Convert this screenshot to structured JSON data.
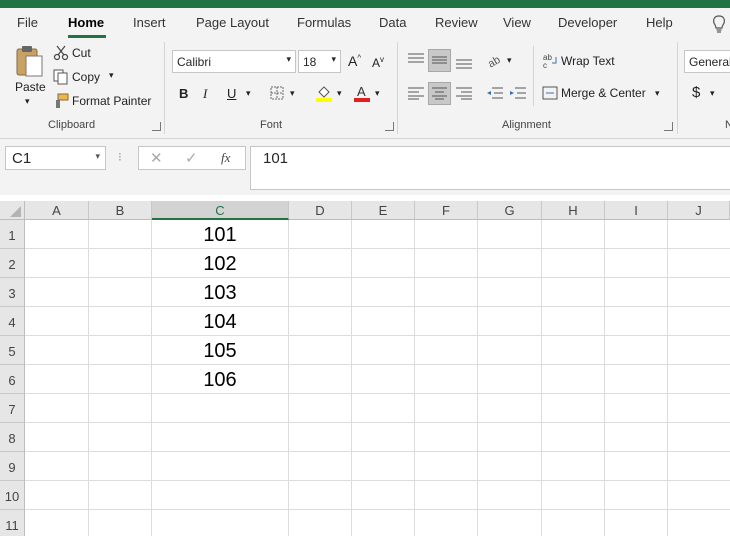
{
  "ribbon_tabs": {
    "file": "File",
    "home": "Home",
    "insert": "Insert",
    "page_layout": "Page Layout",
    "formulas": "Formulas",
    "data": "Data",
    "review": "Review",
    "view": "View",
    "developer": "Developer",
    "help": "Help"
  },
  "clipboard": {
    "paste": "Paste",
    "cut": "Cut",
    "copy": "Copy",
    "format_painter": "Format Painter",
    "group_label": "Clipboard"
  },
  "font": {
    "family": "Calibri",
    "size": "18",
    "bold": "B",
    "italic": "I",
    "underline": "U",
    "group_label": "Font",
    "highlight_color": "#ffff00",
    "font_color": "#e0201c"
  },
  "alignment": {
    "wrap_text": "Wrap Text",
    "merge_center": "Merge & Center",
    "group_label": "Alignment"
  },
  "number": {
    "format": "General",
    "currency": "$",
    "group_label_partial": "N"
  },
  "formula_bar": {
    "name_box": "C1",
    "fx": "fx",
    "value": "101"
  },
  "sheet": {
    "columns": [
      "A",
      "B",
      "C",
      "D",
      "E",
      "F",
      "G",
      "H",
      "I",
      "J"
    ],
    "rows": [
      "1",
      "2",
      "3",
      "4",
      "5",
      "6",
      "7",
      "8",
      "9",
      "10",
      "11"
    ],
    "selected_column": "C",
    "column_c_values": [
      "101",
      "102",
      "103",
      "104",
      "105",
      "106"
    ]
  },
  "colors": {
    "accent": "#217346",
    "ribbon_bg": "#f3f3f3"
  }
}
